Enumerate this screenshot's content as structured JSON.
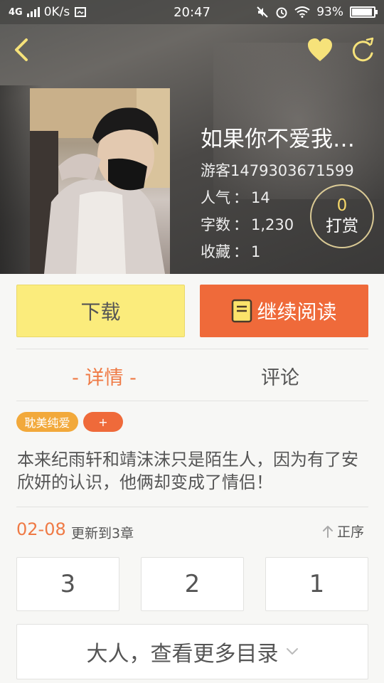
{
  "status_bar": {
    "network": "4G",
    "speed": "0K/s",
    "time": "20:47",
    "battery": "93%",
    "battery_level": 0.93
  },
  "nav": {
    "back_icon": "chevron-left-icon",
    "favorite_icon": "heart-icon",
    "share_icon": "share-icon"
  },
  "book": {
    "title": "如果你不爱我…",
    "author": "游客1479303671599",
    "popularity_label": "人气",
    "popularity": "14",
    "word_count_label": "字数",
    "word_count": "1,230",
    "favorites_label": "收藏",
    "favorites": "1",
    "separator": "："
  },
  "reward": {
    "count": "0",
    "label": "打赏"
  },
  "actions": {
    "download_label": "下载",
    "read_label": "继续阅读"
  },
  "tabs": {
    "detail_label": "- 详情 -",
    "comment_label": "评论"
  },
  "tags": {
    "genre": "耽美纯爱",
    "add": "+"
  },
  "description": "本来纪雨轩和靖沫沫只是陌生人，因为有了安欣妍的认识，他俩却变成了情侣！",
  "update": {
    "date": "02-08",
    "text": "更新到3章",
    "order_label": "正序"
  },
  "chapters": [
    "3",
    "2",
    "1"
  ],
  "more_catalog": "大人，查看更多目录",
  "colors": {
    "accent_orange": "#ef6a3a",
    "accent_yellow": "#fbec7c",
    "tag_orange": "#f2a93b",
    "heart_yellow": "#f6e27a"
  }
}
